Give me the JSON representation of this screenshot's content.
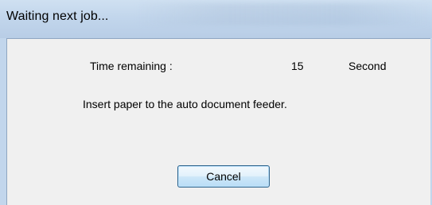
{
  "window": {
    "title": "Waiting next job..."
  },
  "dialog": {
    "time_remaining_label": "Time remaining :",
    "time_remaining_value": "15",
    "time_unit": "Second",
    "message": "Insert paper to the auto document feeder.",
    "cancel_label": "Cancel"
  }
}
